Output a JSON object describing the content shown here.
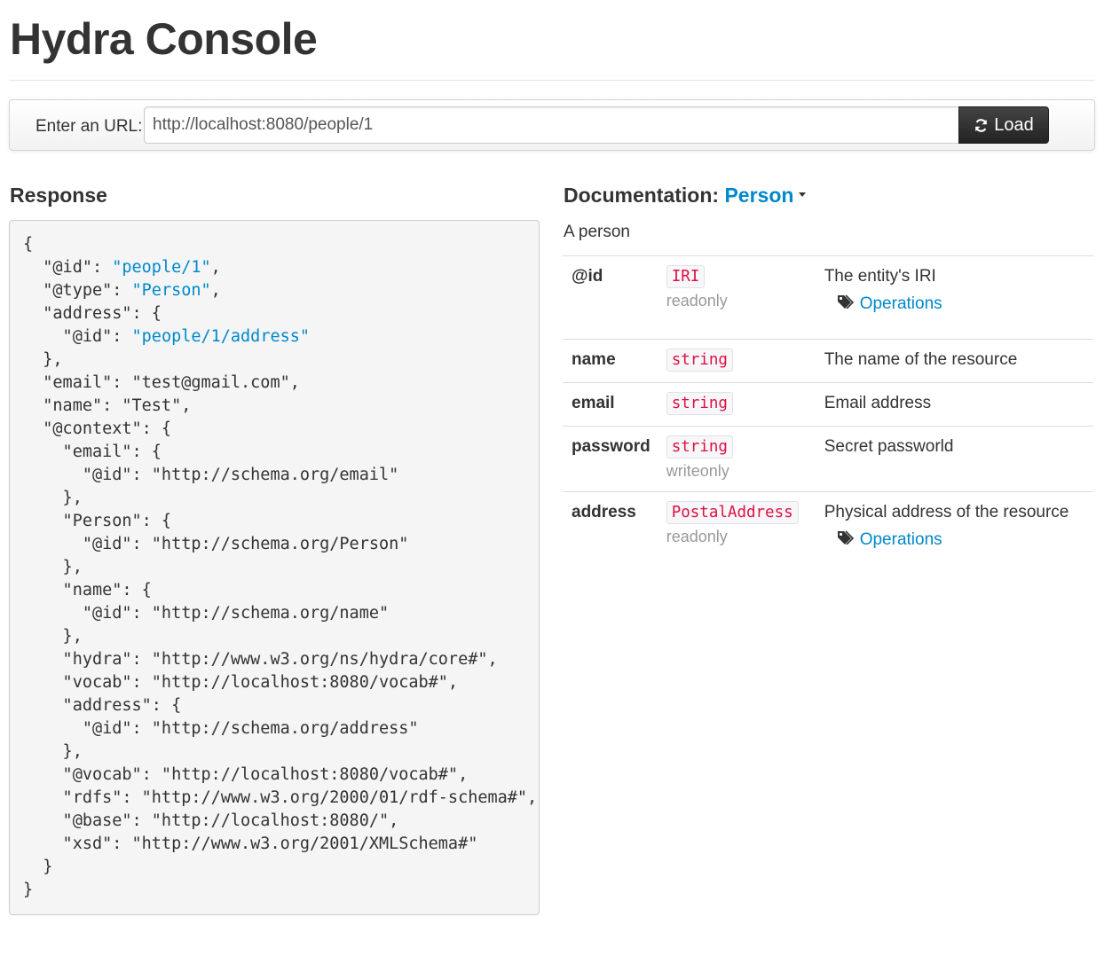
{
  "page": {
    "title": "Hydra Console"
  },
  "url_bar": {
    "label": "Enter an URL:",
    "value": "http://localhost:8080/people/1",
    "load_label": "Load",
    "load_icon": "refresh-icon"
  },
  "response": {
    "title": "Response",
    "json_lines": [
      {
        "indent": 0,
        "pre": "{",
        "link": "",
        "post": ""
      },
      {
        "indent": 1,
        "pre": "\"@id\": ",
        "link": "\"people/1\"",
        "post": ","
      },
      {
        "indent": 1,
        "pre": "\"@type\": ",
        "link": "\"Person\"",
        "post": ","
      },
      {
        "indent": 1,
        "pre": "\"address\": {",
        "link": "",
        "post": ""
      },
      {
        "indent": 2,
        "pre": "\"@id\": ",
        "link": "\"people/1/address\"",
        "post": ""
      },
      {
        "indent": 1,
        "pre": "},",
        "link": "",
        "post": ""
      },
      {
        "indent": 1,
        "pre": "\"email\": \"test@gmail.com\",",
        "link": "",
        "post": ""
      },
      {
        "indent": 1,
        "pre": "\"name\": \"Test\",",
        "link": "",
        "post": ""
      },
      {
        "indent": 1,
        "pre": "\"@context\": {",
        "link": "",
        "post": ""
      },
      {
        "indent": 2,
        "pre": "\"email\": {",
        "link": "",
        "post": ""
      },
      {
        "indent": 3,
        "pre": "\"@id\": \"http://schema.org/email\"",
        "link": "",
        "post": ""
      },
      {
        "indent": 2,
        "pre": "},",
        "link": "",
        "post": ""
      },
      {
        "indent": 2,
        "pre": "\"Person\": {",
        "link": "",
        "post": ""
      },
      {
        "indent": 3,
        "pre": "\"@id\": \"http://schema.org/Person\"",
        "link": "",
        "post": ""
      },
      {
        "indent": 2,
        "pre": "},",
        "link": "",
        "post": ""
      },
      {
        "indent": 2,
        "pre": "\"name\": {",
        "link": "",
        "post": ""
      },
      {
        "indent": 3,
        "pre": "\"@id\": \"http://schema.org/name\"",
        "link": "",
        "post": ""
      },
      {
        "indent": 2,
        "pre": "},",
        "link": "",
        "post": ""
      },
      {
        "indent": 2,
        "pre": "\"hydra\": \"http://www.w3.org/ns/hydra/core#\",",
        "link": "",
        "post": ""
      },
      {
        "indent": 2,
        "pre": "\"vocab\": \"http://localhost:8080/vocab#\",",
        "link": "",
        "post": ""
      },
      {
        "indent": 2,
        "pre": "\"address\": {",
        "link": "",
        "post": ""
      },
      {
        "indent": 3,
        "pre": "\"@id\": \"http://schema.org/address\"",
        "link": "",
        "post": ""
      },
      {
        "indent": 2,
        "pre": "},",
        "link": "",
        "post": ""
      },
      {
        "indent": 2,
        "pre": "\"@vocab\": \"http://localhost:8080/vocab#\",",
        "link": "",
        "post": ""
      },
      {
        "indent": 2,
        "pre": "\"rdfs\": \"http://www.w3.org/2000/01/rdf-schema#\",",
        "link": "",
        "post": ""
      },
      {
        "indent": 2,
        "pre": "\"@base\": \"http://localhost:8080/\",",
        "link": "",
        "post": ""
      },
      {
        "indent": 2,
        "pre": "\"xsd\": \"http://www.w3.org/2001/XMLSchema#\"",
        "link": "",
        "post": ""
      },
      {
        "indent": 1,
        "pre": "}",
        "link": "",
        "post": ""
      },
      {
        "indent": 0,
        "pre": "}",
        "link": "",
        "post": ""
      }
    ]
  },
  "documentation": {
    "title_prefix": "Documentation: ",
    "type_name": "Person",
    "description": "A person",
    "properties": [
      {
        "name": "@id",
        "type": "IRI",
        "flag": "readonly",
        "description": "The entity's IRI",
        "operations": "Operations"
      },
      {
        "name": "name",
        "type": "string",
        "flag": "",
        "description": "The name of the resource",
        "operations": ""
      },
      {
        "name": "email",
        "type": "string",
        "flag": "",
        "description": "Email address",
        "operations": ""
      },
      {
        "name": "password",
        "type": "string",
        "flag": "writeonly",
        "description": "Secret passworld",
        "operations": ""
      },
      {
        "name": "address",
        "type": "PostalAddress",
        "flag": "readonly",
        "description": "Physical address of the resource",
        "operations": "Operations"
      }
    ]
  },
  "colors": {
    "link": "#0088cc",
    "type_text": "#dd1144",
    "muted": "#999999",
    "button_bg": "#333333"
  }
}
